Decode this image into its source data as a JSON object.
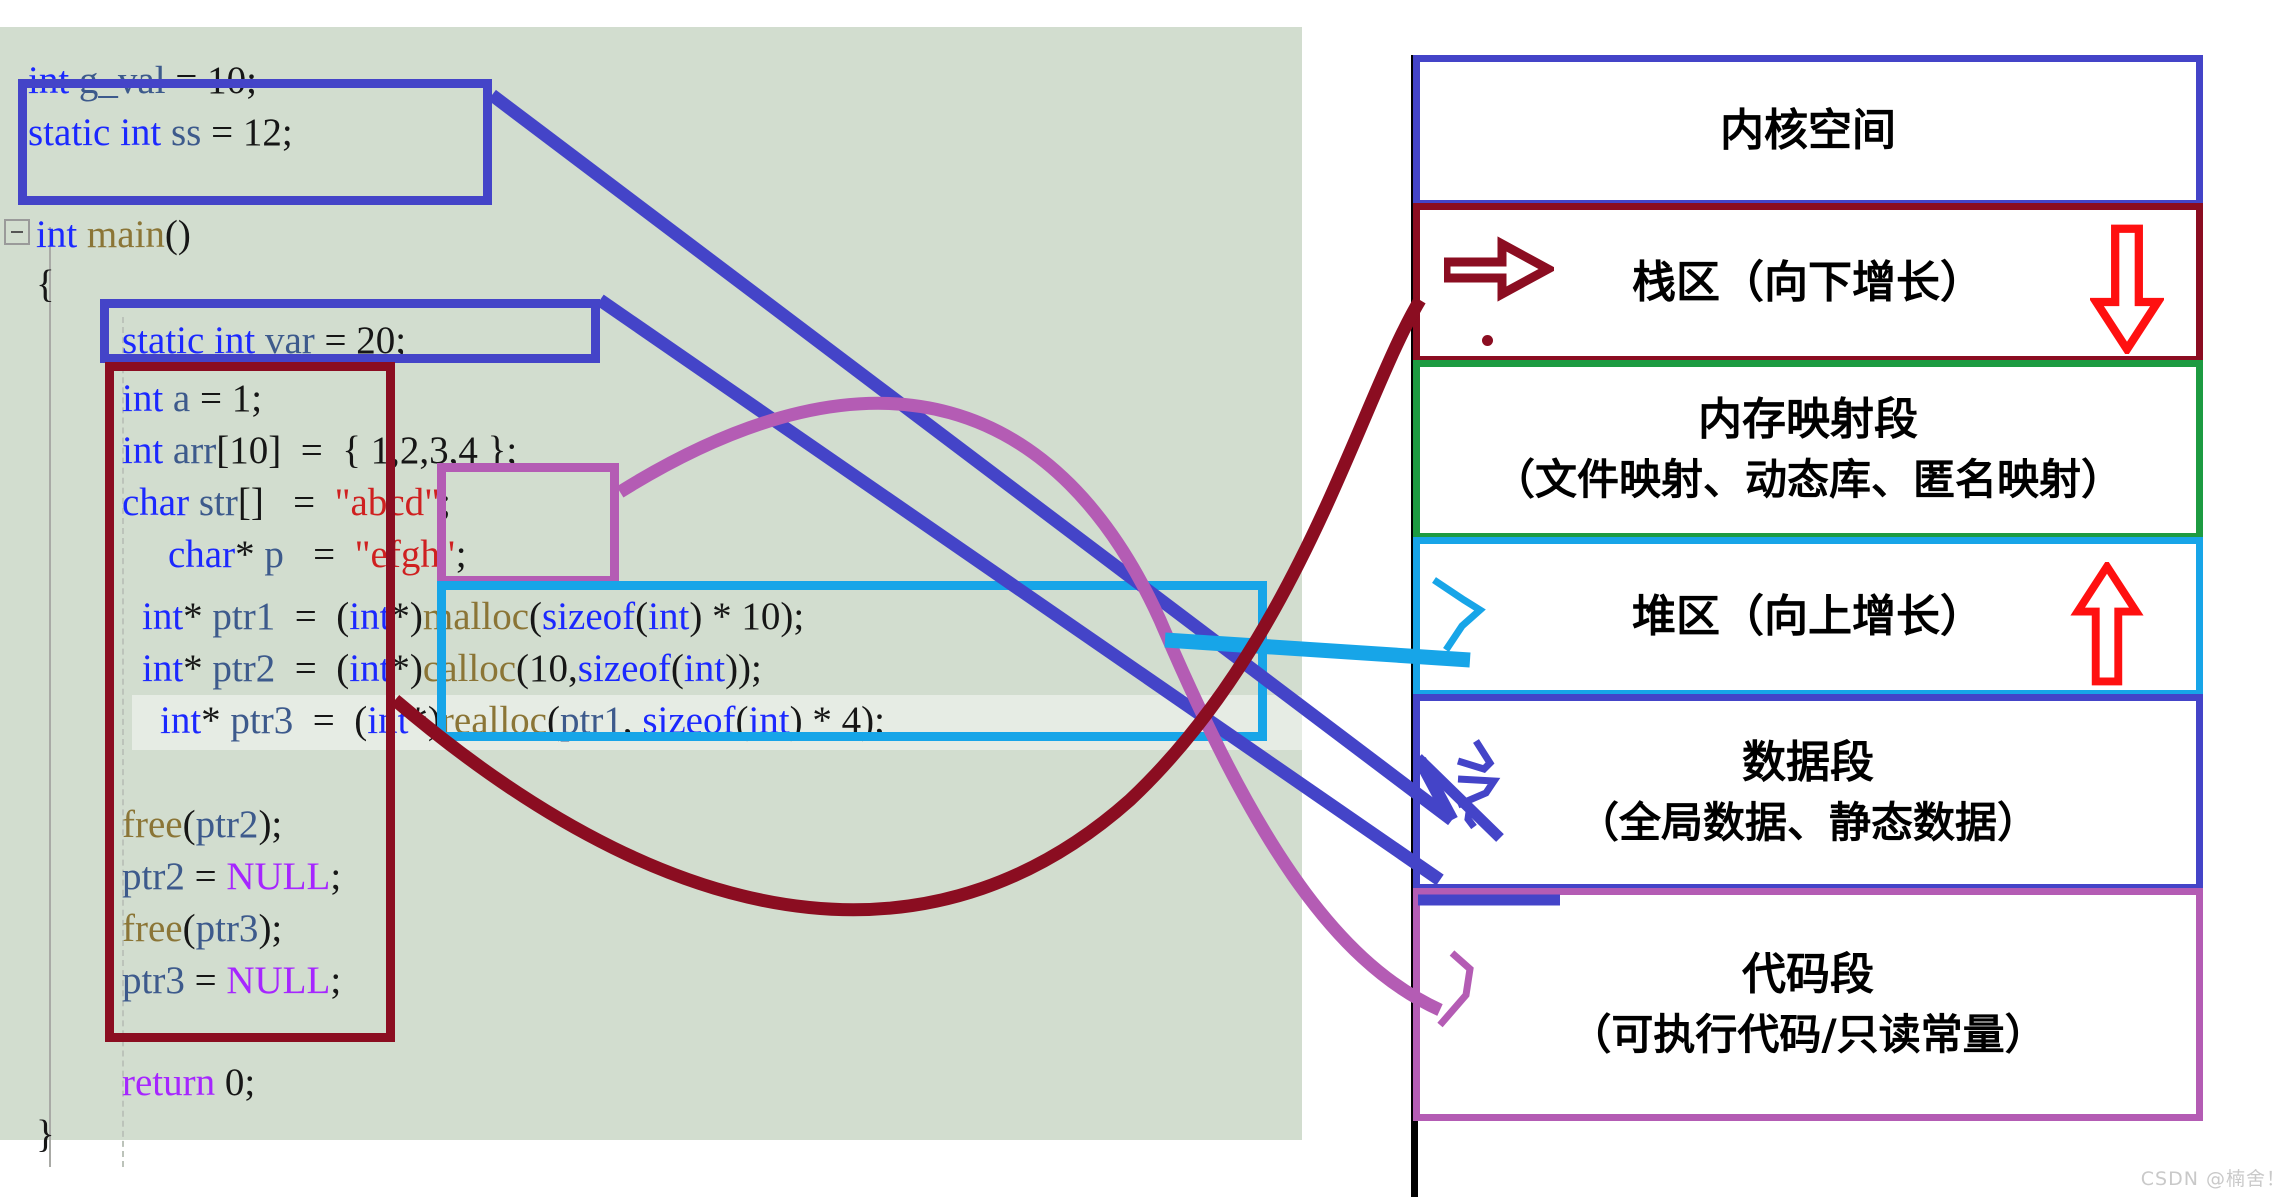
{
  "code": {
    "lines": [
      {
        "id": "g_val",
        "text": "int g_val = 10;"
      },
      {
        "id": "ss",
        "text": "static int ss = 12;"
      },
      {
        "id": "main",
        "text": "int main()"
      },
      {
        "id": "brace_open",
        "text": "{"
      },
      {
        "id": "var",
        "text": "static int var = 20;"
      },
      {
        "id": "a",
        "text": "int a = 1;"
      },
      {
        "id": "arr",
        "text": "int arr[10] = { 1,2,3,4 };"
      },
      {
        "id": "str",
        "text": "char str[] = \"abcd\";"
      },
      {
        "id": "p",
        "text": "char* p = \"efgh\";"
      },
      {
        "id": "ptr1",
        "text": "int* ptr1 = (int*)malloc(sizeof(int) * 10);"
      },
      {
        "id": "ptr2",
        "text": "int* ptr2 = (int*)calloc(10,sizeof(int));"
      },
      {
        "id": "ptr3",
        "text": "int* ptr3 = (int*)realloc(ptr1, sizeof(int) * 4);"
      },
      {
        "id": "free2",
        "text": "free(ptr2);"
      },
      {
        "id": "null2",
        "text": "ptr2 = NULL;"
      },
      {
        "id": "free3",
        "text": "free(ptr3);"
      },
      {
        "id": "null3",
        "text": "ptr3 = NULL;"
      },
      {
        "id": "ret",
        "text": "return 0;"
      },
      {
        "id": "brace_close",
        "text": "}"
      }
    ],
    "tokens": {
      "int": "int",
      "char": "char",
      "static": "static",
      "sizeof": "sizeof",
      "main": "main",
      "malloc": "malloc",
      "calloc": "calloc",
      "realloc": "realloc",
      "free": "free",
      "null": "NULL",
      "return": "return",
      "g_val": "g_val",
      "ss": "ss",
      "var": "var",
      "a": "a",
      "arr": "arr",
      "str": "str",
      "p": "p",
      "ptr1": "ptr1",
      "ptr2": "ptr2",
      "ptr3": "ptr3",
      "abcd": "\"abcd\"",
      "efgh": "\"efgh\"",
      "n10": "10",
      "n12": "12",
      "n20": "20",
      "n1": "1",
      "n4": "4",
      "n0": "0",
      "arr_init": "{ 1,2,3,4 }"
    },
    "highlight_line": "ptr3"
  },
  "memory": {
    "segments": [
      {
        "id": "kernel",
        "line1": "内核空间",
        "line2": "",
        "border": "#4444c8",
        "arrow": ""
      },
      {
        "id": "stack",
        "line1": "栈区（向下增长）",
        "line2": "",
        "border": "#8b0d21",
        "arrow": "down"
      },
      {
        "id": "mmap",
        "line1": "内存映射段",
        "line2": "（文件映射、动态库、匿名映射）",
        "border": "#1d9b41",
        "arrow": ""
      },
      {
        "id": "heap",
        "line1": "堆区（向上增长）",
        "line2": "",
        "border": "#17a5e8",
        "arrow": "up"
      },
      {
        "id": "data",
        "line1": "数据段",
        "line2": "（全局数据、静态数据）",
        "border": "#4444c8",
        "arrow": ""
      },
      {
        "id": "text",
        "line1": "代码段",
        "line2": "（可执行代码/只读常量）",
        "border": "#b45cb4",
        "arrow": ""
      }
    ],
    "growth_arrow_color": "#ff1010"
  },
  "annotation_boxes": [
    {
      "id": "box-global",
      "color": "#4444c8",
      "target": "data"
    },
    {
      "id": "box-static",
      "color": "#4444c8",
      "target": "data"
    },
    {
      "id": "box-stack",
      "color": "#8b0d21",
      "target": "stack"
    },
    {
      "id": "box-rodata",
      "color": "#b45cb4",
      "target": "text"
    },
    {
      "id": "box-heap",
      "color": "#17a5e8",
      "target": "heap"
    }
  ],
  "watermark": "CSDN @楠舍！"
}
